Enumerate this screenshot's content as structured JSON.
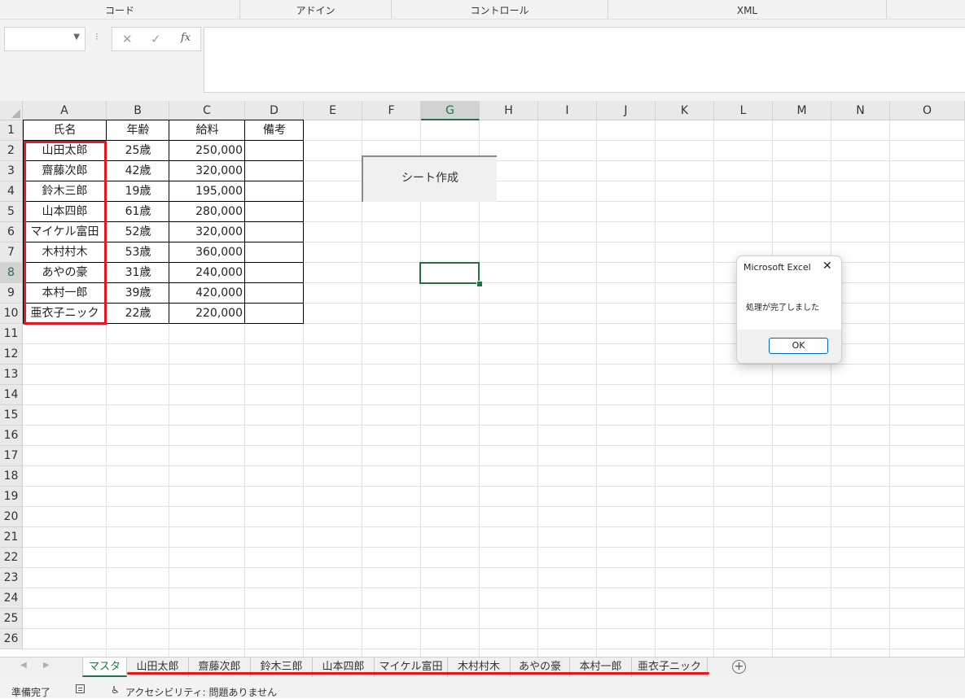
{
  "ribbon": {
    "groups": [
      "コード",
      "アドイン",
      "コントロール",
      "XML"
    ]
  },
  "formula_bar": {
    "name_box": "",
    "cancel_icon": "✕",
    "enter_icon": "✓",
    "fx_label": "fx",
    "formula": ""
  },
  "sheet": {
    "columns": [
      "A",
      "B",
      "C",
      "D",
      "E",
      "F",
      "G",
      "H",
      "I",
      "J",
      "K",
      "L",
      "M",
      "N",
      "O"
    ],
    "selected_column": "G",
    "selected_row": 8,
    "row_numbers": [
      1,
      2,
      3,
      4,
      5,
      6,
      7,
      8,
      9,
      10,
      11,
      12,
      13,
      14,
      15,
      16,
      17,
      18,
      19,
      20,
      21,
      22,
      23,
      24,
      25,
      26
    ],
    "headers": [
      "氏名",
      "年齢",
      "給料",
      "備考"
    ],
    "rows": [
      [
        "山田太郎",
        "25歳",
        "250,000",
        ""
      ],
      [
        "齋藤次郎",
        "42歳",
        "320,000",
        ""
      ],
      [
        "鈴木三郎",
        "19歳",
        "195,000",
        ""
      ],
      [
        "山本四郎",
        "61歳",
        "280,000",
        ""
      ],
      [
        "マイケル富田",
        "52歳",
        "320,000",
        ""
      ],
      [
        "木村村木",
        "53歳",
        "360,000",
        ""
      ],
      [
        "あやの豪",
        "31歳",
        "240,000",
        ""
      ],
      [
        "本村一郎",
        "39歳",
        "420,000",
        ""
      ],
      [
        "亜衣子ニック",
        "22歳",
        "220,000",
        ""
      ]
    ]
  },
  "macro_button": {
    "label": "シート作成"
  },
  "dialog": {
    "title": "Microsoft Excel",
    "close_icon": "✕",
    "message": "処理が完了しました",
    "ok_label": "OK"
  },
  "tabs": {
    "active": "マスタ",
    "items": [
      "マスタ",
      "山田太郎",
      "齋藤次郎",
      "鈴木三郎",
      "山本四郎",
      "マイケル富田",
      "木村村木",
      "あやの豪",
      "本村一郎",
      "亜衣子ニック"
    ],
    "add_icon": "+"
  },
  "status": {
    "ready": "準備完了",
    "accessibility": "アクセシビリティ: 問題ありません"
  },
  "colors": {
    "excel_green": "#217346",
    "highlight_red": "#e8151d"
  }
}
